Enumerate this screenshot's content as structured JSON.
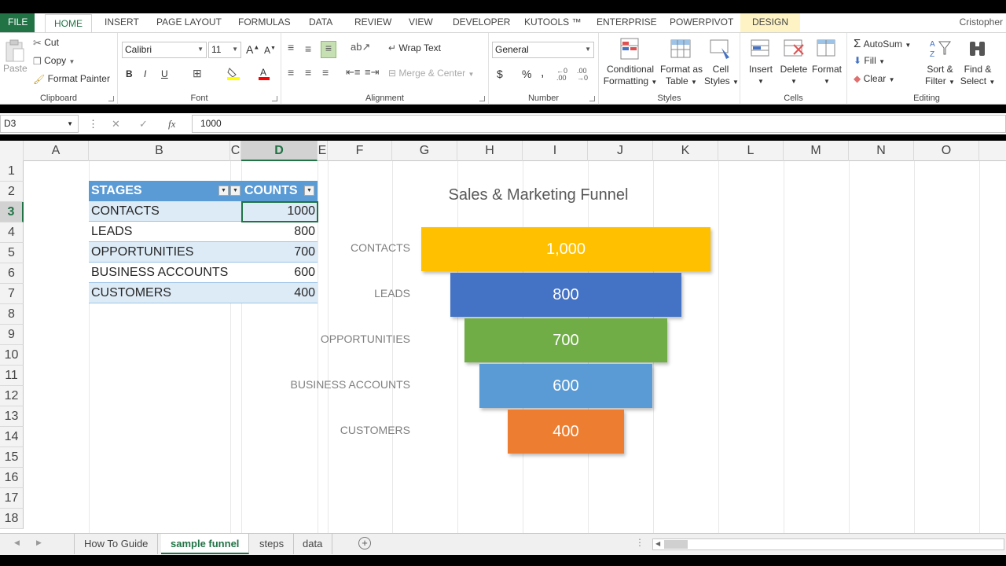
{
  "ribbon_tabs": [
    "FILE",
    "HOME",
    "INSERT",
    "PAGE LAYOUT",
    "FORMULAS",
    "DATA",
    "REVIEW",
    "VIEW",
    "DEVELOPER",
    "KUTOOLS ™",
    "ENTERPRISE",
    "POWERPIVOT",
    "DESIGN"
  ],
  "user": "Cristopher",
  "clipboard": {
    "paste": "Paste",
    "cut": "Cut",
    "copy": "Copy",
    "format_painter": "Format Painter",
    "label": "Clipboard"
  },
  "font": {
    "name": "Calibri",
    "size": "11",
    "bold": "B",
    "italic": "I",
    "underline": "U",
    "label": "Font"
  },
  "alignment": {
    "wrap": "Wrap Text",
    "merge": "Merge & Center",
    "label": "Alignment"
  },
  "number": {
    "format": "General",
    "currency": "$",
    "percent": "%",
    "comma": ",",
    "label": "Number"
  },
  "styles": {
    "conditional": "Conditional",
    "formatting": "Formatting",
    "format_as": "Format as",
    "table": "Table",
    "cell": "Cell",
    "cell_styles": "Styles",
    "label": "Styles"
  },
  "cells": {
    "insert": "Insert",
    "delete": "Delete",
    "format": "Format",
    "label": "Cells"
  },
  "editing": {
    "autosum": "AutoSum",
    "fill": "Fill",
    "clear": "Clear",
    "sort": "Sort &",
    "filter": "Filter",
    "find": "Find &",
    "select": "Select",
    "label": "Editing"
  },
  "formula_bar": {
    "name_box": "D3",
    "value": "1000",
    "fx": "fx"
  },
  "columns": [
    "A",
    "B",
    "C",
    "D",
    "E",
    "F",
    "G",
    "H",
    "I",
    "J",
    "K",
    "L",
    "M",
    "N",
    "O"
  ],
  "rows": [
    "1",
    "2",
    "3",
    "4",
    "5",
    "6",
    "7",
    "8",
    "9",
    "10",
    "11",
    "12",
    "13",
    "14",
    "15",
    "16",
    "17",
    "18"
  ],
  "table": {
    "headers": [
      "STAGES",
      "COUNTS"
    ],
    "rows": [
      {
        "stage": "CONTACTS",
        "count": "1000"
      },
      {
        "stage": "LEADS",
        "count": "800"
      },
      {
        "stage": "OPPORTUNITIES",
        "count": "700"
      },
      {
        "stage": "BUSINESS ACCOUNTS",
        "count": "600"
      },
      {
        "stage": "CUSTOMERS",
        "count": "400"
      }
    ]
  },
  "chart_data": {
    "type": "bar",
    "title": "Sales & Marketing Funnel",
    "categories": [
      "CONTACTS",
      "LEADS",
      "OPPORTUNITIES",
      "BUSINESS ACCOUNTS",
      "CUSTOMERS"
    ],
    "values": [
      1000,
      800,
      700,
      600,
      400
    ],
    "value_labels": [
      "1,000",
      "800",
      "700",
      "600",
      "400"
    ],
    "colors": [
      "#ffc000",
      "#4472c4",
      "#70ad47",
      "#5b9bd5",
      "#ed7d31"
    ]
  },
  "sheet_tabs": [
    "How To Guide",
    "sample funnel",
    "steps",
    "data"
  ]
}
